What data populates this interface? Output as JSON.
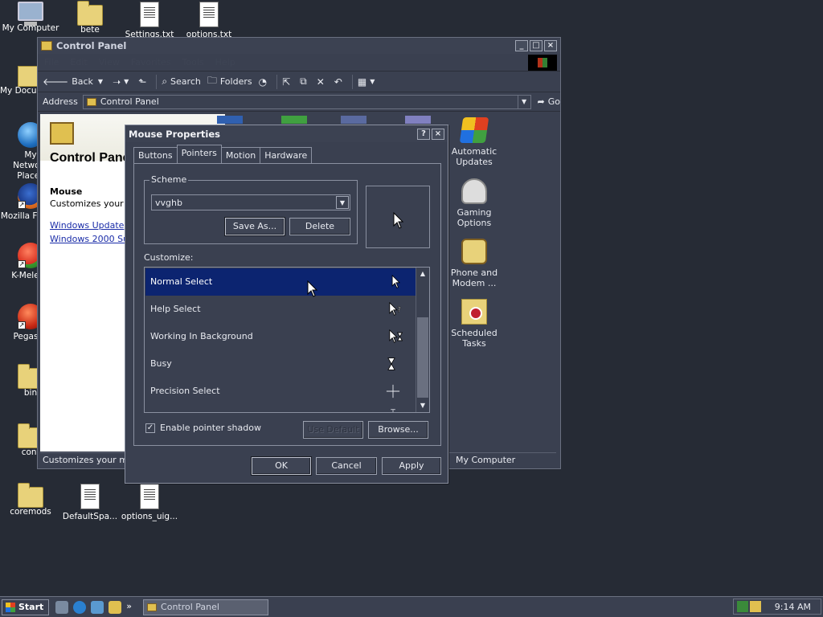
{
  "desktop": {
    "icons": [
      {
        "label": "My Computer"
      },
      {
        "label": "bete"
      },
      {
        "label": "Settings.txt"
      },
      {
        "label": "options.txt"
      },
      {
        "label": "My Documents"
      },
      {
        "label": "My Network Places"
      },
      {
        "label": "Mozilla Firefox"
      },
      {
        "label": "K-Meleon"
      },
      {
        "label": "Pegasus"
      },
      {
        "label": "bin"
      },
      {
        "label": "conf"
      },
      {
        "label": "coremods"
      },
      {
        "label": "DefaultSpa..."
      },
      {
        "label": "options_uig..."
      }
    ]
  },
  "explorer": {
    "title": "Control Panel",
    "menu": [
      "File",
      "Edit",
      "View",
      "Favorites",
      "Tools",
      "Help"
    ],
    "toolbar": {
      "back": "Back",
      "search": "Search",
      "folders": "Folders"
    },
    "address_label": "Address",
    "address_value": "Control Panel",
    "go": "Go",
    "left_pane": {
      "title": "Control Panel",
      "item_title": "Mouse",
      "item_desc": "Customizes your mouse settings.",
      "links": [
        "Windows Update",
        "Windows 2000 Support"
      ]
    },
    "icons": [
      {
        "label": "Automatic Updates"
      },
      {
        "label": "Gaming Options"
      },
      {
        "label": "Phone and Modem ..."
      },
      {
        "label": "Scheduled Tasks"
      }
    ],
    "status_left": "Customizes your mouse settings.",
    "status_right": "My Computer"
  },
  "dialog": {
    "title": "Mouse Properties",
    "help_btn": "?",
    "close_btn": "×",
    "tabs": [
      "Buttons",
      "Pointers",
      "Motion",
      "Hardware"
    ],
    "active_tab": "Pointers",
    "scheme_label": "Scheme",
    "scheme_value": "vvghb",
    "save_as": "Save As...",
    "delete": "Delete",
    "customize_label": "Customize:",
    "pointer_rows": [
      {
        "name": "Normal Select",
        "cursor": "arrow-cursor-icon",
        "selected": true
      },
      {
        "name": "Help Select",
        "cursor": "help-cursor-icon",
        "selected": false
      },
      {
        "name": "Working In Background",
        "cursor": "working-cursor-icon",
        "selected": false
      },
      {
        "name": "Busy",
        "cursor": "hourglass-cursor-icon",
        "selected": false
      },
      {
        "name": "Precision Select",
        "cursor": "crosshair-cursor-icon",
        "selected": false
      }
    ],
    "shadow_label": "Enable pointer shadow",
    "shadow_checked": true,
    "use_default": "Use Default",
    "browse": "Browse...",
    "ok": "OK",
    "cancel": "Cancel",
    "apply": "Apply"
  },
  "taskbar": {
    "start": "Start",
    "task_label": "Control Panel",
    "clock": "9:14 AM"
  }
}
